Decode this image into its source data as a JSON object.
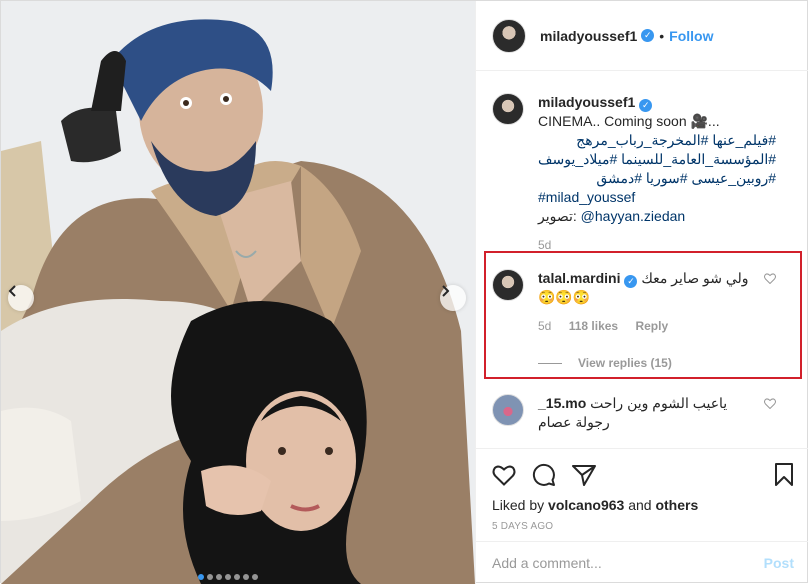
{
  "header": {
    "username": "miladyoussef1",
    "separator": "•",
    "follow_label": "Follow"
  },
  "caption": {
    "username": "miladyoussef1",
    "line1": "CINEMA.. Coming soon 🎥...",
    "hashtag1": "#فيلم_عنها #المخرجة_رباب_مرهج",
    "hashtag2": "#المؤسسة_العامة_للسينما #ميلاد_يوسف",
    "hashtag3": "#روبين_عيسى #سوريا #دمشق",
    "hashtag4": "#milad_youssef",
    "credit_prefix": "تصوير:",
    "credit_mention": "@hayyan.ziedan",
    "time": "5d"
  },
  "highlighted_comment": {
    "username": "talal.mardini",
    "text": "ولي شو صاير معك",
    "emoji": "😳😳😳",
    "time": "5d",
    "likes": "118 likes",
    "reply": "Reply",
    "view_replies": "View replies (15)"
  },
  "comment2": {
    "username": "_15.mo",
    "text": "ياعيب الشوم وين راحت",
    "text2": "رجولة عصام"
  },
  "likes": {
    "prefix": "Liked by",
    "user": "volcano963",
    "middle": "and",
    "others": "others",
    "ago": "5 DAYS AGO"
  },
  "add_comment": {
    "placeholder": "Add a comment...",
    "post_label": "Post"
  },
  "carousel": {
    "slide_count": 7,
    "active_index": 0
  },
  "colors": {
    "accent": "#3897f0",
    "highlight_border": "#d2202b",
    "hashtag": "#003569"
  }
}
